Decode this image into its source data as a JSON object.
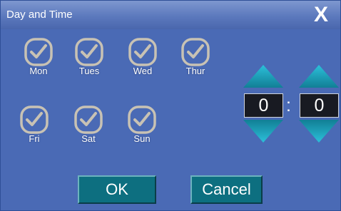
{
  "dialog": {
    "title": "Day and Time",
    "close_label": "X"
  },
  "days": [
    {
      "label": "Mon",
      "checked": true
    },
    {
      "label": "Tues",
      "checked": true
    },
    {
      "label": "Wed",
      "checked": true
    },
    {
      "label": "Thur",
      "checked": true
    },
    {
      "label": "Fri",
      "checked": true
    },
    {
      "label": "Sat",
      "checked": true
    },
    {
      "label": "Sun",
      "checked": true
    }
  ],
  "time": {
    "hour": "0",
    "separator": ":",
    "minute": "0"
  },
  "buttons": {
    "ok": "OK",
    "cancel": "Cancel"
  },
  "colors": {
    "background": "#4a6ab5",
    "checkbox": "#c8c2b4",
    "arrow": "#19a4bf",
    "button": "#0d6f80"
  }
}
